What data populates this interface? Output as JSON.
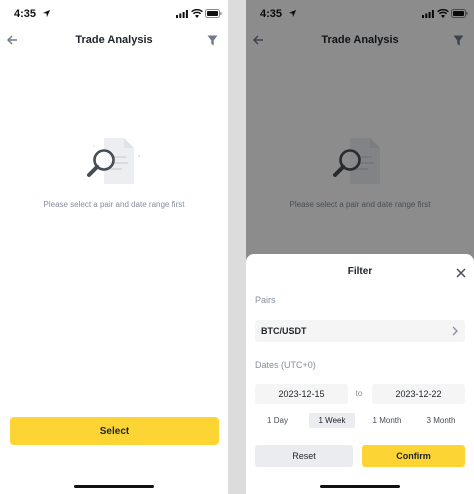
{
  "status_bar": {
    "time": "4:35"
  },
  "nav": {
    "title": "Trade Analysis",
    "back_icon": "back-arrow-icon",
    "filter_icon": "filter-icon"
  },
  "empty_state": {
    "message": "Please select a pair and date range first",
    "illustration": "document-search-icon"
  },
  "actions": {
    "select_label": "Select"
  },
  "filter_sheet": {
    "title": "Filter",
    "pairs_label": "Pairs",
    "pair_value": "BTC/USDT",
    "dates_label": "Dates (UTC+0)",
    "start_date": "2023-12-15",
    "separator": "to",
    "end_date": "2023-12-22",
    "ranges": [
      "1 Day",
      "1 Week",
      "1 Month",
      "3 Month"
    ],
    "selected_range": "1 Week",
    "reset_label": "Reset",
    "confirm_label": "Confirm"
  },
  "colors": {
    "accent": "#fcd535",
    "text_primary": "#1e2329",
    "text_secondary": "#848e9c",
    "overlay": "rgba(0,0,0,0.45)"
  }
}
